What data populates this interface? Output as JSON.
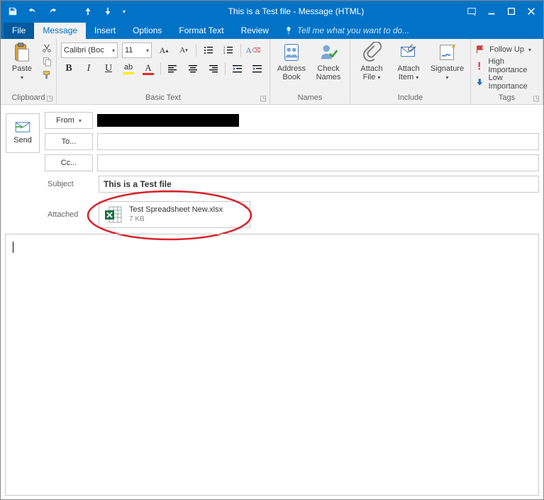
{
  "titlebar": {
    "title": "This is a Test file - Message (HTML)"
  },
  "tabs": {
    "file": "File",
    "message": "Message",
    "insert": "Insert",
    "options": "Options",
    "format": "Format Text",
    "review": "Review",
    "tell": "Tell me what you want to do..."
  },
  "ribbon": {
    "clipboard": {
      "paste": "Paste",
      "label": "Clipboard"
    },
    "basicText": {
      "font": "Calibri (Boc",
      "size": "11",
      "label": "Basic Text"
    },
    "names": {
      "address": "Address\nBook",
      "check": "Check\nNames",
      "label": "Names"
    },
    "include": {
      "attachFile": "Attach\nFile",
      "attachItem": "Attach\nItem",
      "signature": "Signature",
      "label": "Include"
    },
    "tags": {
      "followUp": "Follow Up",
      "high": "High Importance",
      "low": "Low Importance",
      "label": "Tags"
    }
  },
  "compose": {
    "send": "Send",
    "from": "From",
    "to": "To...",
    "cc": "Cc...",
    "subjectLabel": "Subject",
    "subjectValue": "This is a Test file",
    "attachedLabel": "Attached",
    "attachment": {
      "name": "Test Spreadsheet New.xlsx",
      "size": "7 KB"
    }
  }
}
